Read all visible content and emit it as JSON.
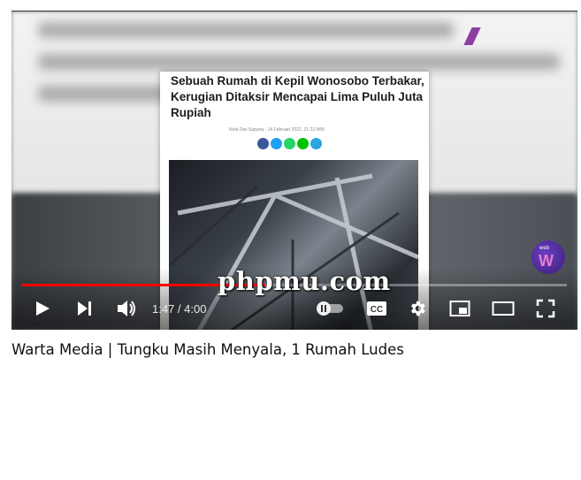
{
  "video": {
    "title": "Warta Media | Tungku Masih Menyala, 1 Rumah Ludes",
    "current_time": "1:47",
    "duration": "4:00",
    "time_display": "1:47 / 4:00",
    "progress_fraction": 0.446,
    "watermark_text": "phpmu.com"
  },
  "article_card": {
    "headline": "Sebuah Rumah di Kepil Wonosobo Terbakar, Kerugian Ditaksir Mencapai Lima Puluh Juta Rupiah",
    "byline": "Nofa Dwi Saputra · 14 Februari 2022, 21:22 WIB",
    "share_buttons": [
      {
        "icon": "facebook-icon",
        "color": "#3b5998"
      },
      {
        "icon": "twitter-icon",
        "color": "#1da1f2"
      },
      {
        "icon": "whatsapp-icon",
        "color": "#25d366"
      },
      {
        "icon": "line-icon",
        "color": "#00c300"
      },
      {
        "icon": "telegram-icon",
        "color": "#2ca5e0"
      }
    ]
  },
  "channel_badge": {
    "small_text": "web",
    "big_text": "W"
  },
  "controls": {
    "play": "play-icon",
    "next": "next-icon",
    "volume": "volume-icon",
    "autoplay": "autoplay-toggle-icon",
    "captions": "CC",
    "settings": "gear-icon",
    "miniplayer": "miniplayer-icon",
    "theater": "theater-icon",
    "fullscreen": "fullscreen-icon"
  },
  "colors": {
    "progress": "#ff0000",
    "accent": "#8e3ea0"
  }
}
